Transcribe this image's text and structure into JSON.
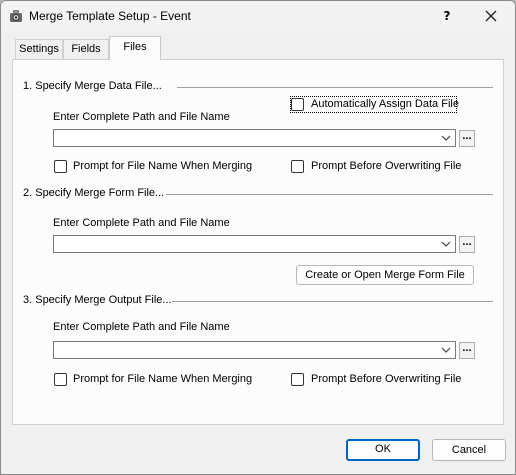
{
  "window": {
    "title": "Merge Template Setup - Event",
    "help_label": "?"
  },
  "tabs": [
    {
      "label": "Settings",
      "active": false
    },
    {
      "label": "Fields",
      "active": false
    },
    {
      "label": "Files",
      "active": true
    }
  ],
  "section1": {
    "heading": "1. Specify Merge Data File...",
    "auto_assign_label": "Automatically Assign Data File",
    "path_label": "Enter Complete Path and File Name",
    "path_value": "",
    "browse_label": "...",
    "prompt_name_label": "Prompt for File Name When Merging",
    "prompt_overwrite_label": "Prompt Before Overwriting File"
  },
  "section2": {
    "heading": "2. Specify Merge Form File...",
    "path_label": "Enter Complete Path and File Name",
    "path_value": "",
    "browse_label": "...",
    "create_button_label": "Create or Open Merge Form File"
  },
  "section3": {
    "heading": "3. Specify Merge Output File...",
    "path_label": "Enter Complete Path and File Name",
    "path_value": "",
    "browse_label": "...",
    "prompt_name_label": "Prompt for File Name When Merging",
    "prompt_overwrite_label": "Prompt Before Overwriting File"
  },
  "footer": {
    "ok_label": "OK",
    "cancel_label": "Cancel"
  }
}
